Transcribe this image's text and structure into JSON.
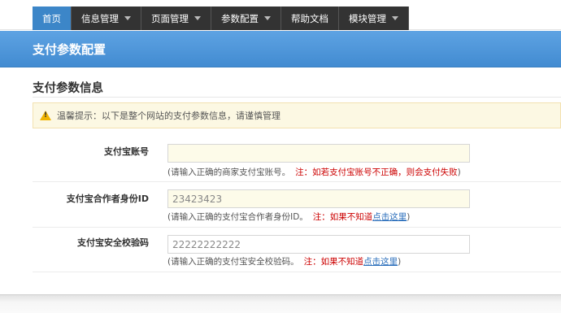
{
  "nav": {
    "items": [
      {
        "label": "首页",
        "active": true,
        "dropdown": false
      },
      {
        "label": "信息管理",
        "active": false,
        "dropdown": true
      },
      {
        "label": "页面管理",
        "active": false,
        "dropdown": true
      },
      {
        "label": "参数配置",
        "active": false,
        "dropdown": true
      },
      {
        "label": "帮助文档",
        "active": false,
        "dropdown": false
      },
      {
        "label": "模块管理",
        "active": false,
        "dropdown": true
      }
    ]
  },
  "banner": {
    "title": "支付参数配置"
  },
  "section": {
    "title": "支付参数信息"
  },
  "alert": {
    "icon": "warning-icon",
    "text": "温馨提示：以下是整个网站的支付参数信息，请谨慎管理"
  },
  "form": {
    "rows": [
      {
        "label": "支付宝账号",
        "value": "",
        "hint_prefix": "(请输入正确的商家支付宝账号。",
        "hint_warn": "注：如若支付宝账号不正确，则会支付失败",
        "hint_link": "",
        "hint_suffix": ")"
      },
      {
        "label": "支付宝合作者身份ID",
        "value": "23423423",
        "hint_prefix": "(请输入正确的支付宝合作者身份ID。",
        "hint_warn": "注：如果不知道",
        "hint_link": "点击这里",
        "hint_suffix": ")"
      },
      {
        "label": "支付宝安全校验码",
        "value": "22222222222",
        "hint_prefix": "(请输入正确的支付宝安全校验码。",
        "hint_warn": "注：如果不知道",
        "hint_link": "点击这里",
        "hint_suffix": ")"
      }
    ]
  },
  "colors": {
    "nav_bg": "#333333",
    "nav_active": "#3c86c8",
    "banner": "#4a93d8",
    "alert_bg": "#fcf8e3",
    "warn_text": "#cc0000",
    "link": "#2a6ebb"
  }
}
